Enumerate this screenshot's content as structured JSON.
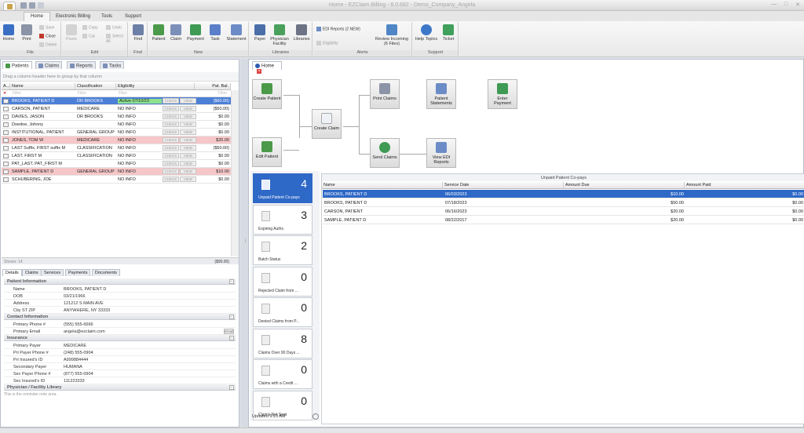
{
  "app": {
    "title": "Home - EZClaim Billing - 8.0.682 - Demo_Company_Angela"
  },
  "ribbon_tabs": [
    "Home",
    "Electronic Billing",
    "Tools",
    "Support"
  ],
  "ribbon": {
    "groups": [
      "File",
      "Edit",
      "Find",
      "New",
      "Libraries",
      "Alerts",
      "Support"
    ],
    "file": {
      "home": "Home",
      "print": "Print",
      "save": "Save",
      "close": "Close",
      "delete": "Delete"
    },
    "edit": {
      "paste": "Paste",
      "copy": "Copy",
      "cut": "Cut",
      "undo": "Undo",
      "select_all": "Select All"
    },
    "find": {
      "find": "Find"
    },
    "new": {
      "patient": "Patient",
      "claim": "Claim",
      "payment": "Payment",
      "task": "Task",
      "statement": "Statement"
    },
    "libraries": {
      "payer": "Payer",
      "physician": "Physician Facility",
      "libraries": "Libraries"
    },
    "alerts": {
      "edi_reports": "EDI Reports (2 NEW)",
      "eligibility": "Eligibility",
      "review_incoming": "Review Incoming (6 Files)"
    },
    "support": {
      "help": "Help Topics",
      "ticket": "Ticket"
    }
  },
  "left_tabs": [
    "Patients",
    "Claims",
    "Reports",
    "Tasks"
  ],
  "patients_grid": {
    "groupby_hint": "Drag a column header here to group by that column",
    "columns": [
      "A...",
      "Name",
      "Classification",
      "Eligibility",
      "Pat. Bal."
    ],
    "filter_placeholder": "Filter",
    "check_label": "CHECK",
    "view_label": "VIEW",
    "rows": [
      {
        "name": "BROOKS, PATIENT D",
        "classification": "DR BROOKS",
        "eligibility": "Active 07/10/23",
        "balance": "($60.00)",
        "style": "sel"
      },
      {
        "name": "CARSON, PATIENT",
        "classification": "MEDICARE",
        "eligibility": "NO INFO",
        "balance": "($50.00)",
        "style": ""
      },
      {
        "name": "DAVIES, JASON",
        "classification": "DR BROOKS",
        "eligibility": "NO INFO",
        "balance": "$0.00",
        "style": ""
      },
      {
        "name": "Doedoe, Johnny",
        "classification": "",
        "eligibility": "NO INFO",
        "balance": "$0.00",
        "style": ""
      },
      {
        "name": "INSTITUTIONAL, PATIENT",
        "classification": "GENERAL GROUP",
        "eligibility": "NO INFO",
        "balance": "$0.00",
        "style": ""
      },
      {
        "name": "JONES, TOM W",
        "classification": "MEDICARE",
        "eligibility": "NO INFO",
        "balance": "$20.00",
        "style": "red"
      },
      {
        "name": "LAST Suffix, FIRST suffix M",
        "classification": "CLASSIFICATION",
        "eligibility": "NO INFO",
        "balance": "($50.00)",
        "style": ""
      },
      {
        "name": "LAST, FIRST M",
        "classification": "CLASSIFICATION",
        "eligibility": "NO INFO",
        "balance": "$0.00",
        "style": ""
      },
      {
        "name": "PAT_LAST, PAT_FIRST M",
        "classification": "",
        "eligibility": "NO INFO",
        "balance": "$0.00",
        "style": ""
      },
      {
        "name": "SAMPLE, PATIENT D",
        "classification": "GENERAL GROUP",
        "eligibility": "NO INFO",
        "balance": "$10.00",
        "style": "red"
      },
      {
        "name": "SCHUBERING, JOE",
        "classification": "",
        "eligibility": "NO INFO",
        "balance": "$0.00",
        "style": ""
      }
    ],
    "footer_count": "Shown: 14",
    "footer_total": "($90.00)"
  },
  "detail_tabs": [
    "Details",
    "Claims",
    "Services",
    "Payments",
    "Documents"
  ],
  "details": {
    "sections": {
      "patient": "Patient Information",
      "contact": "Contact Information",
      "insurance": "Insurance",
      "library": "Physician / Facility Library"
    },
    "patient": [
      {
        "label": "Name",
        "value": "BROOKS, PATIENT D"
      },
      {
        "label": "DOB",
        "value": "03/21/1966"
      },
      {
        "label": "Address",
        "value": "121212 S MAIN AVE"
      },
      {
        "label": "City ST ZIP",
        "value": "ANYWHERE, NY 33333"
      }
    ],
    "contact": [
      {
        "label": "Primary Phone #",
        "value": "(555) 555-6666"
      },
      {
        "label": "Primary Email",
        "value": "angela@ezclaim.com"
      }
    ],
    "email_btn": "Email",
    "insurance": [
      {
        "label": "Primary Payer",
        "value": "MEDICARE"
      },
      {
        "label": "Pri Payer Phone #",
        "value": "(248) 555-0904"
      },
      {
        "label": "Pri Insured's ID",
        "value": "A999884444"
      },
      {
        "label": "Secondary Payer",
        "value": "HUMANA"
      },
      {
        "label": "Sec Payer Phone #",
        "value": "(877) 555-0904"
      },
      {
        "label": "Sec Insured's ID",
        "value": "111223333"
      }
    ],
    "note": "This is the reminder note area."
  },
  "home_tab": "Home",
  "workflow": {
    "create_patient": "Create Patient",
    "edit_patient": "Edit Patient",
    "create_claim": "Create Claim",
    "print_claims": "Print Claims",
    "send_claims": "Send Claims",
    "patient_statements": "Patient Statements",
    "enter_payment": "Enter Payment",
    "view_edi": "View EDI Reports"
  },
  "cards": [
    {
      "count": "4",
      "label": "Unpaid Patient Co-pays"
    },
    {
      "count": "3",
      "label": "Expiring Auths"
    },
    {
      "count": "2",
      "label": "Batch Status"
    },
    {
      "count": "0",
      "label": "Rejected Claim from ..."
    },
    {
      "count": "0",
      "label": "Denied Claims from P..."
    },
    {
      "count": "8",
      "label": "Claims Over 90 Days ..."
    },
    {
      "count": "0",
      "label": "Claims with a Credit ..."
    },
    {
      "count": "0",
      "label": "Claims Not Sent"
    }
  ],
  "updated": "Updated 9:23 AM",
  "unpaid": {
    "title": "Unpaid Patient Co-pays",
    "columns": [
      "Name",
      "Service Date",
      "Amount Due",
      "Amount Paid"
    ],
    "rows": [
      {
        "name": "BROOKS, PATIENT D",
        "date": "06/03/2023",
        "due": "$10.00",
        "paid": "$0.00"
      },
      {
        "name": "BROOKS, PATIENT D",
        "date": "07/18/2023",
        "due": "$50.00",
        "paid": "$0.00"
      },
      {
        "name": "CARSON, PATIENT",
        "date": "06/16/2023",
        "due": "$20.00",
        "paid": "$0.00"
      },
      {
        "name": "SAMPLE, PATIENT D",
        "date": "08/22/2017",
        "due": "$20.00",
        "paid": "$0.00"
      }
    ]
  },
  "colors": {
    "accent": "#2f69c7",
    "selected_row": "#4c7fd6",
    "warning_row": "#f6c7c8",
    "active_elig": "#8ee28e"
  }
}
